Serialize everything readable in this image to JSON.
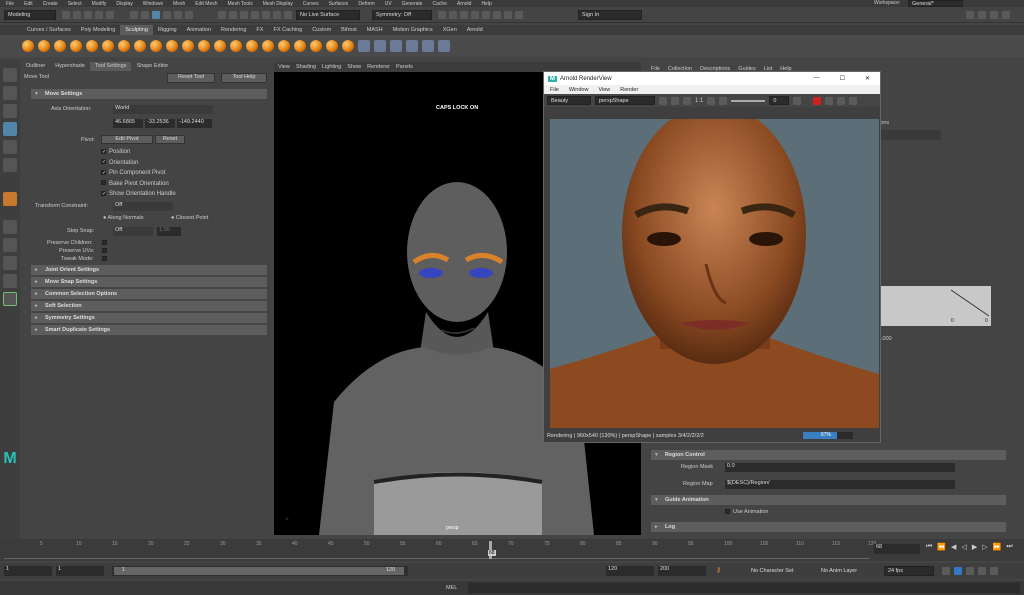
{
  "menubar": {
    "items": [
      "File",
      "Edit",
      "Create",
      "Select",
      "Modify",
      "Display",
      "Windows",
      "Mesh",
      "Edit Mesh",
      "Mesh Tools",
      "Mesh Display",
      "Curves",
      "Surfaces",
      "Deform",
      "UV",
      "Generate",
      "Cache",
      "Arnold",
      "Help"
    ],
    "workspace_label": "Workspace:",
    "workspace_value": "General*"
  },
  "statusline": {
    "mode": "Modeling",
    "live_surface": "No Live Surface",
    "symmetry": "Symmetry: Off",
    "signin": "Sign In"
  },
  "shelf": {
    "tabs": [
      "Curves / Surfaces",
      "Poly Modeling",
      "Sculpting",
      "Rigging",
      "Animation",
      "Rendering",
      "FX",
      "FX Caching",
      "Custom",
      "Bifrost",
      "MASH",
      "Motion Graphics",
      "XGen",
      "Arnold"
    ],
    "active_tab": "Sculpting"
  },
  "tool_panel": {
    "tabs": [
      "Outliner",
      "Hypershade",
      "Tool Settings",
      "Shape Editor"
    ],
    "tool_name": "Move Tool",
    "reset_tool": "Reset Tool",
    "tool_help": "Tool Help",
    "sections": {
      "move_settings": "Move Settings",
      "joint_orient": "Joint Orient Settings",
      "move_snap": "Move Snap Settings",
      "common_selection": "Common Selection Options",
      "soft_selection": "Soft Selection",
      "symmetry": "Symmetry Settings",
      "smart_duplicate": "Smart Duplicate Settings"
    },
    "axis_orientation_label": "Axis Orientation:",
    "axis_orientation_value": "World",
    "axis_values": [
      "46.6865",
      "-33.2536",
      "-149.2440"
    ],
    "pivot_label": "Pivot:",
    "edit_pivot": "Edit Pivot",
    "reset": "Reset",
    "checks": [
      {
        "label": "Position",
        "checked": true
      },
      {
        "label": "Orientation",
        "checked": true
      },
      {
        "label": "Pin Component Pivot",
        "checked": true
      },
      {
        "label": "Bake Pivot Orientation",
        "checked": false
      },
      {
        "label": "Show Orientation Handle",
        "checked": true
      }
    ],
    "transform_constraint_label": "Transform Constraint:",
    "transform_constraint_value": "Off",
    "along_normals": "Along Normals",
    "closest_point": "Closest Point",
    "step_snap_label": "Step Snap:",
    "step_snap_value": "Off",
    "step_snap_num": "1.00",
    "preserve_children": "Preserve Children:",
    "preserve_uvs": "Preserve UVs:",
    "tweak_mode": "Tweak Mode:"
  },
  "viewport": {
    "menu": [
      "View",
      "Shading",
      "Lighting",
      "Show",
      "Renderer",
      "Panels"
    ],
    "caps_lock": "CAPS LOCK ON",
    "camera": "persp"
  },
  "render_view": {
    "title": "Arnold RenderView",
    "menu": [
      "File",
      "Window",
      "View",
      "Render"
    ],
    "aov": "Beauty",
    "camera": "perspShape",
    "ratio": "1:1",
    "exposure": "0",
    "status": "Rendering | 960x540 (130%) | perspShape | samples 3/4/2/2/2/2",
    "progress": "67%",
    "progress_value": 0.67
  },
  "attr_editor": {
    "menu": [
      "File",
      "Collection",
      "Descriptions",
      "Guides",
      "List",
      "Help"
    ],
    "region_control": "Region Control",
    "region_mask_label": "Region Mask",
    "region_mask_value": "0.0",
    "region_map_label": "Region Map",
    "region_map_value": "${DESC}/Region/",
    "guide_animation": "Guide Animation",
    "use_animation": "Use Animation",
    "log": "Log",
    "partial_value": ".000",
    "partial_tab": "ions",
    "graph_zero_a": "0",
    "graph_zero_b": "0"
  },
  "timeline": {
    "ticks": [
      "5",
      "10",
      "15",
      "20",
      "25",
      "30",
      "35",
      "40",
      "45",
      "50",
      "55",
      "60",
      "65",
      "70",
      "75",
      "80",
      "85",
      "90",
      "95",
      "100",
      "105",
      "110",
      "115",
      "120"
    ],
    "current_frame": "68",
    "frame_field": "68"
  },
  "range": {
    "start": "1",
    "start2": "1",
    "slider_start": "1",
    "slider_end": "120",
    "end": "120",
    "end2": "200",
    "character_set": "No Character Set",
    "anim_layer": "No Anim Layer",
    "fps": "24 fps"
  },
  "cmdline": {
    "label": "MEL"
  }
}
